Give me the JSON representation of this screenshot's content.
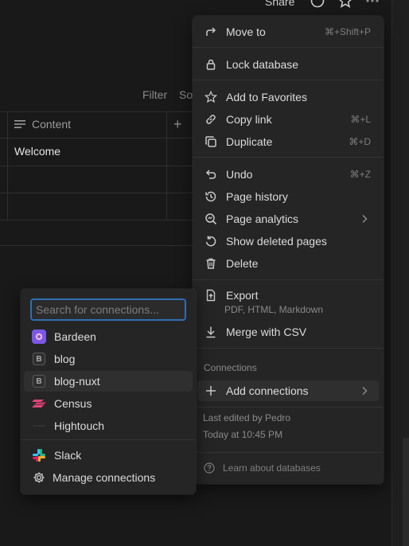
{
  "topbar": {
    "share_label": "Share"
  },
  "table": {
    "filter_label": "Filter",
    "sort_label": "So",
    "column_header": "Content",
    "add_column_symbol": "+",
    "rows": [
      "Welcome",
      "",
      ""
    ]
  },
  "menu": {
    "move_to": {
      "label": "Move to",
      "shortcut": "⌘+Shift+P"
    },
    "lock_database": {
      "label": "Lock database"
    },
    "add_to_favorites": {
      "label": "Add to Favorites"
    },
    "copy_link": {
      "label": "Copy link",
      "shortcut": "⌘+L"
    },
    "duplicate": {
      "label": "Duplicate",
      "shortcut": "⌘+D"
    },
    "undo": {
      "label": "Undo",
      "shortcut": "⌘+Z"
    },
    "page_history": {
      "label": "Page history"
    },
    "page_analytics": {
      "label": "Page analytics"
    },
    "show_deleted_pages": {
      "label": "Show deleted pages"
    },
    "delete": {
      "label": "Delete"
    },
    "export": {
      "label": "Export",
      "sublabel": "PDF, HTML, Markdown"
    },
    "merge_with_csv": {
      "label": "Merge with CSV"
    },
    "connections_section": "Connections",
    "add_connections": {
      "label": "Add connections"
    },
    "last_edited_by": "Last edited by Pedro",
    "last_edited_time": "Today at 10:45 PM",
    "learn_about_databases": "Learn about databases"
  },
  "connections_popover": {
    "search_placeholder": "Search for connections...",
    "items": [
      {
        "label": "Bardeen",
        "icon": "bardeen-icon"
      },
      {
        "label": "blog",
        "icon": "b-letter-icon"
      },
      {
        "label": "blog-nuxt",
        "icon": "b-letter-icon"
      },
      {
        "label": "Census",
        "icon": "census-icon"
      },
      {
        "label": "Hightouch",
        "icon": "hightouch-icon"
      }
    ],
    "slack_label": "Slack",
    "manage_label": "Manage connections"
  },
  "colors": {
    "background": "#191919",
    "menu_bg": "#252525",
    "hover_bg": "#2f2f2f",
    "focus_ring": "#2e6fb3"
  }
}
